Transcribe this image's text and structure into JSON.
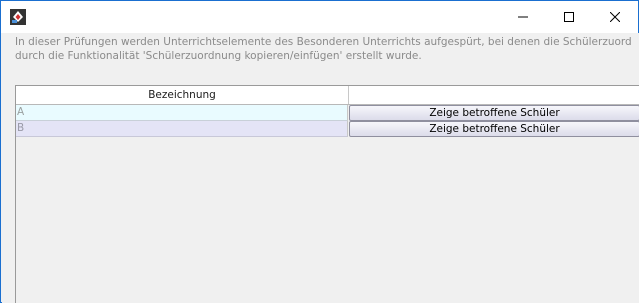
{
  "window": {
    "title": "",
    "controls": {
      "minimize": "minimize-icon",
      "maximize": "maximize-icon",
      "close": "close-icon"
    }
  },
  "description": {
    "line1": "In dieser Prüfungen werden Unterrichtselemente des Besonderen Unterrichts aufgespürt, bei denen die Schülerzuord",
    "line2": "durch die Funktionalität 'Schülerzuordnung kopieren/einfügen' erstellt wurde."
  },
  "table": {
    "columns": [
      "Bezeichnung",
      ""
    ],
    "rows": [
      {
        "name": "A",
        "action": "Zeige betroffene Schüler"
      },
      {
        "name": "B",
        "action": "Zeige betroffene Schüler"
      }
    ]
  }
}
